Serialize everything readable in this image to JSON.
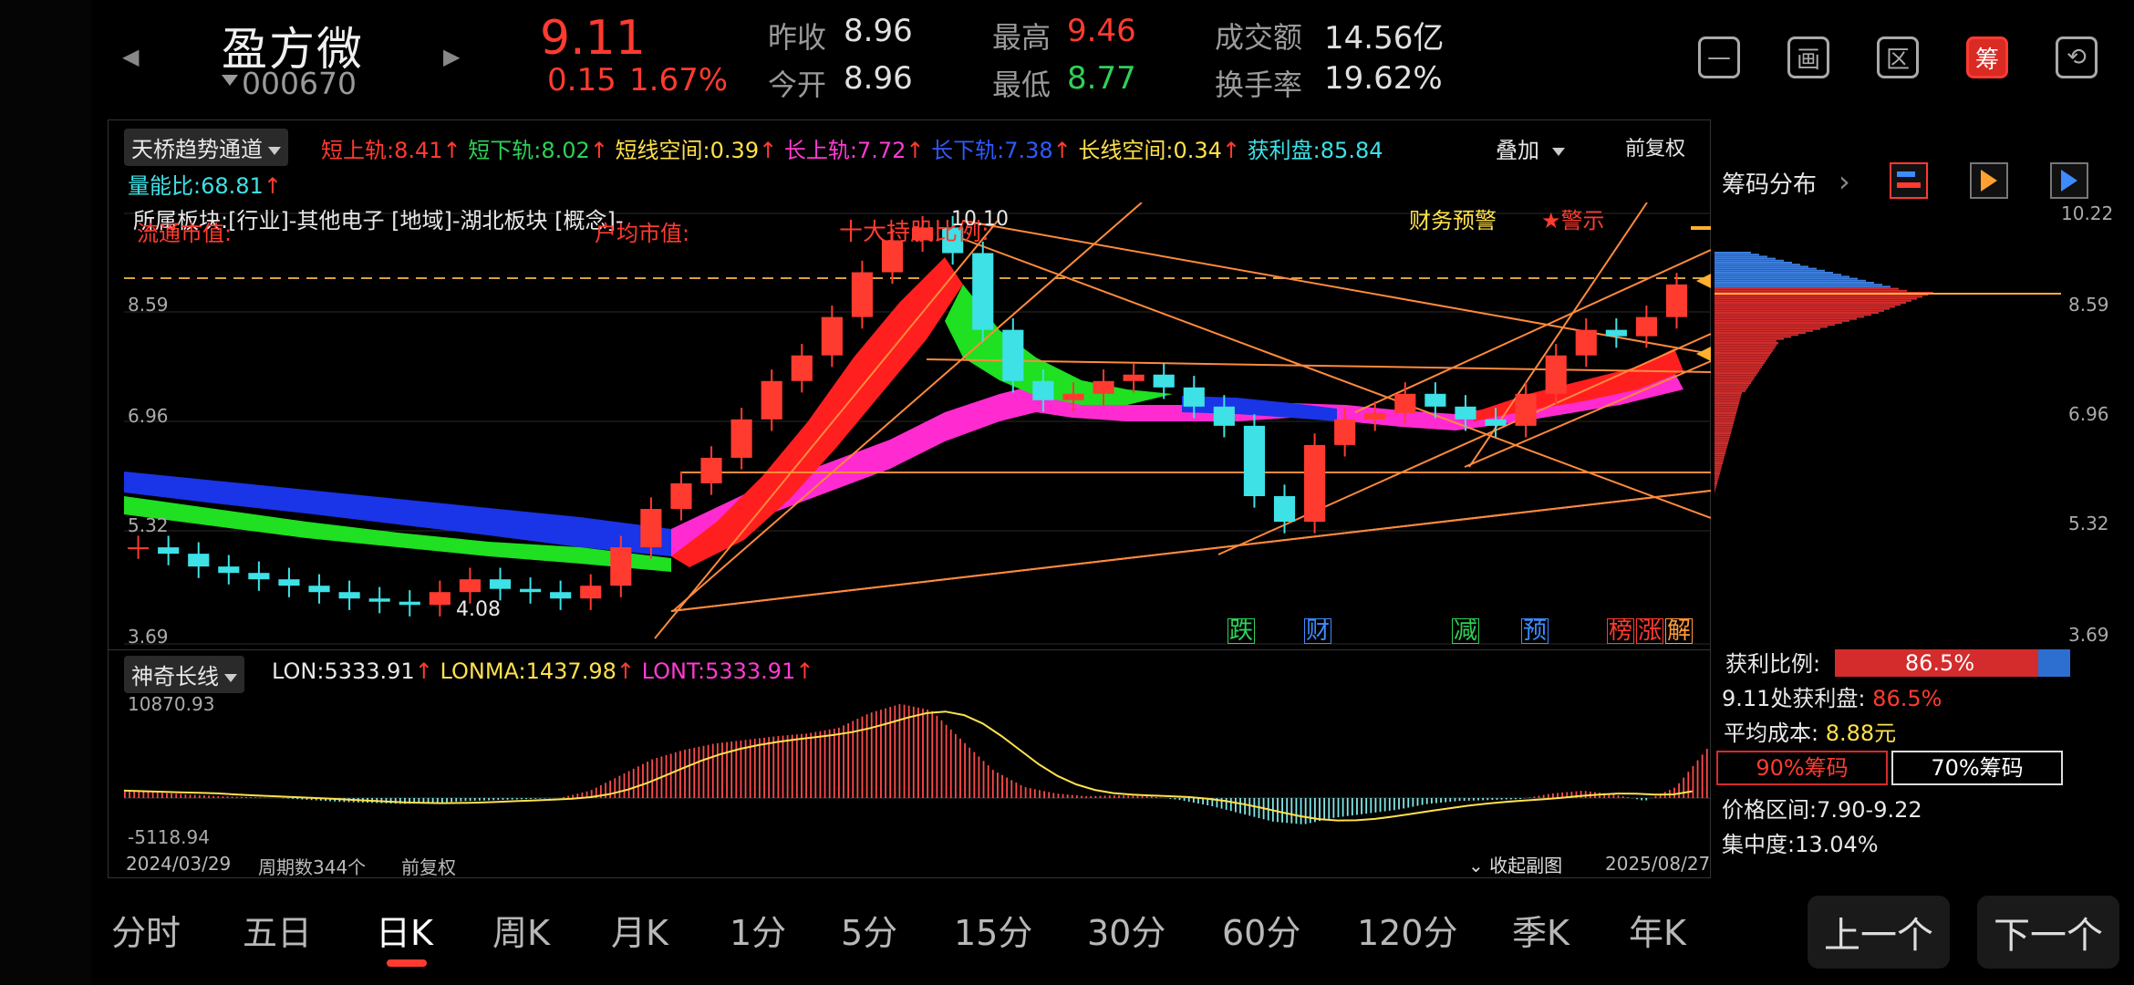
{
  "header": {
    "name": "盈方微",
    "code": "000670",
    "price": "9.11",
    "change": "0.15",
    "change_pct": "1.67%",
    "quotes": [
      {
        "label": "昨收",
        "value": "8.96",
        "color": "#e0e0e0"
      },
      {
        "label": "今开",
        "value": "8.96",
        "color": "#e0e0e0"
      },
      {
        "label": "最高",
        "value": "9.46",
        "color": "#ff3b30"
      },
      {
        "label": "最低",
        "value": "8.77",
        "color": "#2ed158"
      },
      {
        "label": "成交额",
        "value": "14.56亿",
        "color": "#e0e0e0"
      },
      {
        "label": "换手率",
        "value": "19.62%",
        "color": "#e0e0e0"
      }
    ],
    "tools": [
      {
        "icon": "minus-box-icon",
        "glyph": "—"
      },
      {
        "icon": "picture-icon",
        "glyph": "画"
      },
      {
        "icon": "region-icon",
        "glyph": "区"
      },
      {
        "icon": "chips-icon",
        "glyph": "筹"
      },
      {
        "icon": "phone-rotate-icon",
        "glyph": "⟲"
      }
    ]
  },
  "main_chart": {
    "indicator": "天桥趋势通道",
    "overlay_label": "叠加",
    "adjust_label": "前复权",
    "values": [
      {
        "label": "短上轨:",
        "value": "8.41",
        "color": "#ff3b30"
      },
      {
        "label": "短下轨:",
        "value": "8.02",
        "color": "#2ed158"
      },
      {
        "label": "短线空间:",
        "value": "0.39",
        "color": "#ffe14d"
      },
      {
        "label": "长上轨:",
        "value": "7.72",
        "color": "#ff3bd4"
      },
      {
        "label": "长下轨:",
        "value": "7.38",
        "color": "#2f5bff"
      },
      {
        "label": "长线空间:",
        "value": "0.34",
        "color": "#ffe14d"
      },
      {
        "label": "获利盘:",
        "value": "85.84",
        "color": "#3de1e6"
      }
    ],
    "volume_ratio_label": "量能比:",
    "volume_ratio": "68.81",
    "sector_text": "所属板块:[行业]-其他电子 [地域]-湖北板块 [概念]-",
    "circ_text": "流通市值:",
    "holders_text": "户均市值:",
    "top10_text": "十大持股比例:",
    "warn_text": "财务预警",
    "warn2_text": "★警示",
    "y_ticks": [
      "10.22",
      "8.59",
      "6.96",
      "5.32",
      "3.69"
    ],
    "peak_label": "10.10",
    "low_label": "4.08",
    "markers": [
      {
        "text": "跌",
        "color": "#2ed158"
      },
      {
        "text": "财",
        "color": "#3d8bff"
      },
      {
        "text": "减",
        "color": "#2ed158"
      },
      {
        "text": "预",
        "color": "#3d8bff"
      },
      {
        "text": "榜",
        "color": "#ff3b30"
      },
      {
        "text": "涨",
        "color": "#ff3b30"
      },
      {
        "text": "解",
        "color": "#ff9a3b"
      }
    ]
  },
  "sub_chart": {
    "indicator": "神奇长线",
    "values": [
      {
        "label": "LON:",
        "value": "5333.91",
        "color": "#e8e8e8"
      },
      {
        "label": "LONMA:",
        "value": "1437.98",
        "color": "#ffe14d"
      },
      {
        "label": "LONT:",
        "value": "5333.91",
        "color": "#ff3bd4"
      }
    ],
    "y_max": "10870.93",
    "y_min": "-5118.94"
  },
  "footer_info": {
    "start_date": "2024/03/29",
    "periods": "周期数344个",
    "adjust": "前复权",
    "collapse": "收起副图",
    "end_date": "2025/08/27"
  },
  "chips": {
    "title": "筹码分布",
    "price_top": "10.22",
    "price_859": "8.59",
    "price_696": "6.96",
    "price_532": "5.32",
    "price_bot": "3.69",
    "profit_ratio_label": "获利比例:",
    "profit_ratio": "86.5%",
    "profit_ratio_value": 0.865,
    "at_price_label": "9.11处获利盘:",
    "at_price_value": "86.5%",
    "avg_cost_label": "平均成本:",
    "avg_cost": "8.88元",
    "btn90": "90%筹码",
    "btn70": "70%筹码",
    "range_label": "价格区间:",
    "range": "7.90-9.22",
    "conc_label": "集中度:",
    "conc": "13.04%"
  },
  "tabs": [
    "分时",
    "五日",
    "日K",
    "周K",
    "月K",
    "1分",
    "5分",
    "15分",
    "30分",
    "60分",
    "120分",
    "季K",
    "年K"
  ],
  "active_tab": "日K",
  "nav": {
    "prev": "上一个",
    "next": "下一个"
  },
  "chart_data": {
    "type": "candlestick",
    "title": "",
    "x_range": [
      "2024/03/29",
      "2025/08/27"
    ],
    "ylim": [
      3.69,
      10.22
    ],
    "close_series": [
      5.0,
      4.9,
      4.7,
      4.6,
      4.5,
      4.4,
      4.3,
      4.2,
      4.15,
      4.1,
      4.3,
      4.5,
      4.35,
      4.3,
      4.2,
      4.4,
      5.0,
      5.6,
      6.0,
      6.4,
      7.0,
      7.6,
      8.0,
      8.6,
      9.3,
      9.8,
      10.0,
      9.6,
      8.4,
      7.6,
      7.3,
      7.4,
      7.6,
      7.7,
      7.5,
      7.2,
      6.9,
      5.8,
      5.4,
      6.6,
      7.0,
      7.1,
      7.4,
      7.2,
      7.0,
      6.9,
      7.4,
      8.0,
      8.4,
      8.3,
      8.6,
      9.11
    ],
    "lon_series": [
      800,
      600,
      400,
      200,
      100,
      0,
      -200,
      -400,
      -500,
      -600,
      -500,
      -300,
      -200,
      -100,
      0,
      800,
      2500,
      4200,
      5200,
      5900,
      6300,
      6700,
      7000,
      7600,
      9200,
      10200,
      9500,
      6200,
      3000,
      1200,
      500,
      200,
      300,
      200,
      -200,
      -800,
      -1600,
      -2400,
      -2700,
      -2000,
      -1600,
      -1200,
      -600,
      -300,
      -200,
      -100,
      500,
      800,
      400,
      -300,
      1200,
      5333.91
    ]
  }
}
